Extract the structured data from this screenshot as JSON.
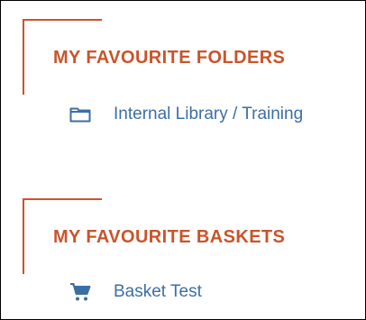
{
  "favourite_folders": {
    "heading": "MY FAVOURITE FOLDERS",
    "items": [
      {
        "label": "Internal Library / Training",
        "icon": "folder-icon"
      }
    ]
  },
  "favourite_baskets": {
    "heading": "MY FAVOURITE BASKETS",
    "items": [
      {
        "label": "Basket Test",
        "icon": "cart-icon"
      }
    ]
  },
  "colors": {
    "accent": "#c8552a",
    "link": "#3c6ea5",
    "border": "#000000"
  }
}
